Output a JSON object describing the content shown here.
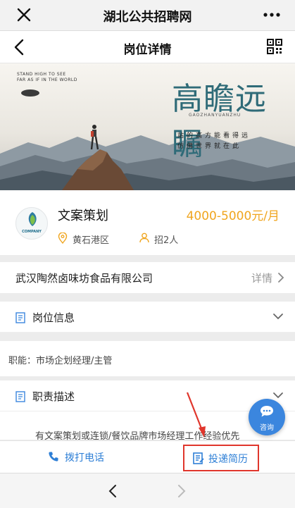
{
  "app": {
    "title": "湖北公共招聘网"
  },
  "nav": {
    "title": "岗位详情"
  },
  "banner": {
    "slogan_line1": "STAND HIGH TO SEE",
    "slogan_line2": "FAR AS IF IN THE WORLD",
    "headline": "高瞻远瞩",
    "pinyin": "GAOZHANYUANZHU",
    "line1": "站的高方能看得远",
    "line2": "仿佛世界就在此"
  },
  "job": {
    "logo_text": "COMPANY",
    "title": "文案策划",
    "salary": "4000-5000元/月",
    "location": "黄石港区",
    "headcount": "招2人"
  },
  "company": {
    "name": "武汉陶然卤味坊食品有限公司",
    "detail_label": "详情"
  },
  "sections": {
    "position_info": "岗位信息",
    "duties": "职责描述"
  },
  "position_info": {
    "function": "职能：市场企划经理/主管"
  },
  "duties": {
    "text": "有文案策划或连锁/餐饮品牌市场经理工作经验优先"
  },
  "actions": {
    "call_label": "拨打电话",
    "apply_label": "投递简历"
  },
  "consult": {
    "label": "咨询"
  },
  "colors": {
    "salary": "#f0a51e",
    "accent_blue": "#2e7fd6",
    "highlight_red": "#e0362c",
    "consult_bg": "#3b86de"
  }
}
